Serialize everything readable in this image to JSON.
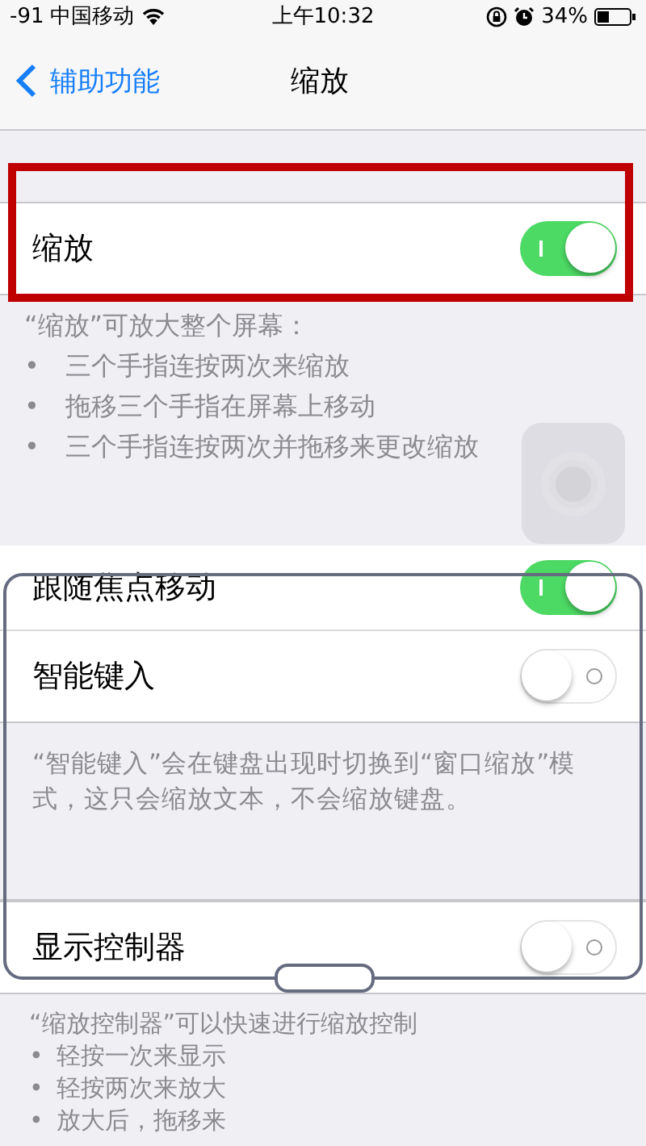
{
  "status_bar": {
    "signal": "-91",
    "carrier": "中国移动",
    "time": "上午10:32",
    "battery": "34%"
  },
  "nav": {
    "back": "辅助功能",
    "title": "缩放"
  },
  "sections": [
    {
      "rows": [
        {
          "label": "缩放",
          "on": true,
          "highlight": true
        }
      ],
      "footer": [
        {
          "kind": "heading",
          "text": "“缩放”可放大整个屏幕："
        },
        {
          "kind": "bullet",
          "mark": "•",
          "text": "三个手指连按两次来缩放"
        },
        {
          "kind": "bullet",
          "mark": "•",
          "text": "拖移三个手指在屏幕上移动"
        },
        {
          "kind": "bullet",
          "mark": "•",
          "text": "三个手指连按两次并拖移来更改缩放"
        }
      ]
    },
    {
      "rows": [
        {
          "label": "跟随焦点移动",
          "on": true,
          "highlight": false
        },
        {
          "label": "智能键入",
          "on": false,
          "highlight": false
        }
      ],
      "footer": [
        {
          "kind": "paragraph",
          "text": "“智能键入”会在键盘出现时切换到“窗口缩放”模式，这只会缩放文本，不会缩放键盘。"
        }
      ]
    },
    {
      "rows": [
        {
          "label": "显示控制器",
          "on": false,
          "highlight": false
        }
      ],
      "footer": [
        {
          "kind": "heading",
          "text": "“缩放控制器”可以快速进行缩放控制"
        },
        {
          "kind": "bullet",
          "mark": "•",
          "text": "轻按一次来显示"
        },
        {
          "kind": "bullet",
          "mark": "•",
          "text": "轻按两次来放大"
        },
        {
          "kind": "bullet",
          "mark": "•",
          "text": "放大后，拖移来"
        }
      ]
    }
  ]
}
